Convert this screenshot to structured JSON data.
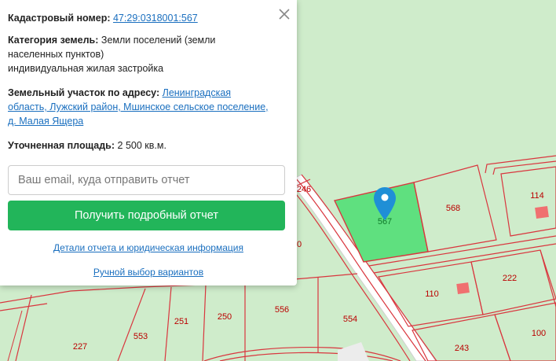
{
  "popup": {
    "cadastral_label": "Кадастровый номер:",
    "cadastral_number": "47:29:0318001:567",
    "category_label": "Категория земель:",
    "category_value_line1": "Земли поселений (земли",
    "category_value_line2": "населенных пунктов)",
    "category_value_line3": "индивидуальная жилая застройка",
    "address_label": "Земельный участок по адресу:",
    "address_line1": "Ленинградская",
    "address_line2": "область, Лужский район, Мшинское сельское поселение,",
    "address_line3": "д. Малая Ящера",
    "area_label": "Уточненная площадь:",
    "area_value": "2 500 кв.м.",
    "email_placeholder": "Ваш email, куда отправить отчет",
    "submit_label": "Получить подробный отчет",
    "details_link": "Детали отчета и юридическая информация",
    "manual_link": "Ручной выбор вариантов"
  },
  "map": {
    "parcel_labels": {
      "p246": "246",
      "p567": "567",
      "p568": "568",
      "p114": "114",
      "p222": "222",
      "p110": "110",
      "p556": "556",
      "p554": "554",
      "p251": "251",
      "p250": "250",
      "p553": "553",
      "p227": "227",
      "p243": "243",
      "p100": "100",
      "p0": "0"
    },
    "colors": {
      "background": "#cfeccb",
      "boundary": "#d9363e",
      "selected_fill": "#5fe07f",
      "building": "#f07070",
      "marker": "#1f8fd6",
      "road": "#e0e0e0",
      "button": "#22b55a",
      "link": "#1a6fbf"
    },
    "marker_icon": "map-pin-icon"
  }
}
